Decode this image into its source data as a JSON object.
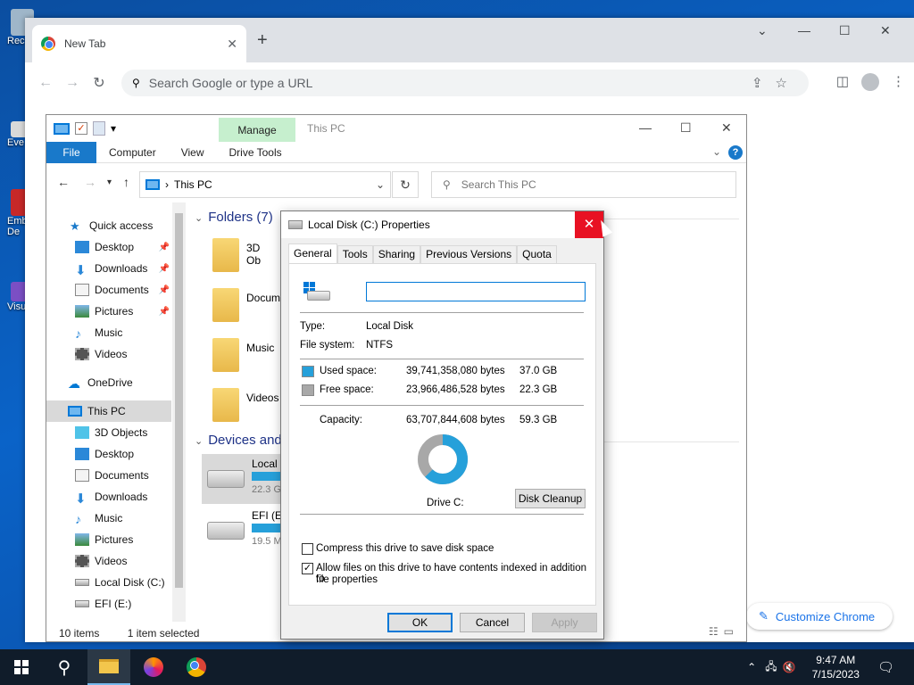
{
  "desktop": {
    "icons": [
      {
        "label": "Rec",
        "color": "#9fb6c9"
      },
      {
        "label": "Eve",
        "color": "#d9d9d9"
      },
      {
        "label": "Emb",
        "label2": "De",
        "color": "#c62828"
      },
      {
        "label": "Visu",
        "color": "#7b4fc4"
      }
    ]
  },
  "chrome": {
    "tab_title": "New Tab",
    "omnibox_placeholder": "Search Google or type a URL",
    "customize_label": "Customize Chrome"
  },
  "explorer": {
    "window_title": "This PC",
    "manage_tab": "Manage",
    "ribbon_tabs": [
      "File",
      "Computer",
      "View",
      "Drive Tools"
    ],
    "address": "This PC",
    "search_placeholder": "Search This PC",
    "nav": {
      "quick_access": "Quick access",
      "quick_items": [
        "Desktop",
        "Downloads",
        "Documents",
        "Pictures",
        "Music",
        "Videos"
      ],
      "onedrive": "OneDrive",
      "this_pc": "This PC",
      "pc_items": [
        "3D Objects",
        "Desktop",
        "Documents",
        "Downloads",
        "Music",
        "Pictures",
        "Videos",
        "Local Disk (C:)",
        "EFI (E:)"
      ]
    },
    "folders_header": "Folders (7)",
    "folders": [
      "3D Ob",
      "Docum",
      "Music",
      "Videos"
    ],
    "devices_header": "Devices and",
    "drives": [
      {
        "name": "Local",
        "free": "22.3 G"
      },
      {
        "name": "EFI (E:",
        "free": "19.5 M"
      }
    ],
    "status_items": "10 items",
    "status_selected": "1 item selected"
  },
  "dialog": {
    "title": "Local Disk (C:) Properties",
    "tabs": [
      "General",
      "Tools",
      "Sharing",
      "Previous Versions",
      "Quota"
    ],
    "label_value": "",
    "type_label": "Type:",
    "type_value": "Local Disk",
    "fs_label": "File system:",
    "fs_value": "NTFS",
    "used_label": "Used space:",
    "used_bytes": "39,741,358,080 bytes",
    "used_gb": "37.0 GB",
    "free_label": "Free space:",
    "free_bytes": "23,966,486,528 bytes",
    "free_gb": "22.3 GB",
    "capacity_label": "Capacity:",
    "capacity_bytes": "63,707,844,608 bytes",
    "capacity_gb": "59.3 GB",
    "used_fraction": 0.624,
    "used_color": "#26a0da",
    "free_color": "#a8a8a8",
    "drive_label": "Drive C:",
    "cleanup_button": "Disk Cleanup",
    "compress_label": "Compress this drive to save disk space",
    "compress_checked": false,
    "index_label": "Allow files on this drive to have contents indexed in addition to",
    "index_label2": "file properties",
    "index_checked": true,
    "ok": "OK",
    "cancel": "Cancel",
    "apply": "Apply"
  },
  "taskbar": {
    "time": "9:47 AM",
    "date": "7/15/2023"
  }
}
